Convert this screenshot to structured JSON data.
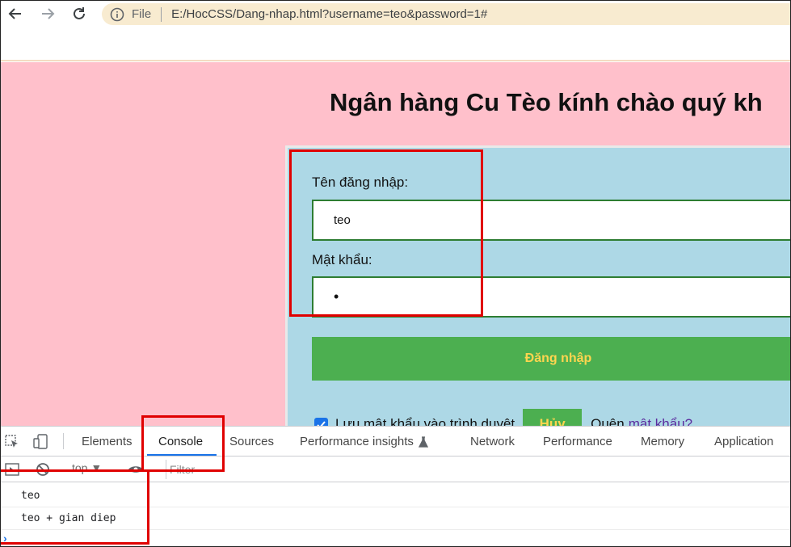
{
  "browser": {
    "file_label": "File",
    "url": "E:/HocCSS/Dang-nhap.html?username=teo&password=1#",
    "icons": [
      "back-arrow-icon",
      "forward-arrow-icon",
      "reload-icon",
      "info-icon"
    ]
  },
  "page": {
    "title": "Ngân hàng Cu Tèo kính chào quý kh",
    "username_label": "Tên đăng nhập:",
    "username_value": "teo",
    "password_label": "Mật khẩu:",
    "password_value": "•",
    "login_button": "Đăng nhập",
    "remember_label": "Lưu mật khẩu vào trình duyệt",
    "remember_checked": true,
    "cancel_button": "Hủy",
    "forgot_text": "Quên",
    "forgot_link": "mật khẩu?",
    "colors": {
      "page_bg": "#ffc0cb",
      "panel_bg": "#add8e6",
      "button_bg": "#4caf50",
      "button_text": "#ffd54f",
      "input_border": "#2e7d32"
    }
  },
  "devtools": {
    "tabs": [
      {
        "label": "Elements"
      },
      {
        "label": "Console"
      },
      {
        "label": "Sources"
      },
      {
        "label": "Performance insights"
      },
      {
        "label": "Network"
      },
      {
        "label": "Performance"
      },
      {
        "label": "Memory"
      },
      {
        "label": "Application"
      }
    ],
    "active_tab": "Console",
    "context": "top ▼",
    "filter_placeholder": "Filter",
    "console_lines": [
      "teo",
      "teo + gian diep"
    ],
    "prompt": "›"
  },
  "annotations": {
    "color": "#e00000"
  }
}
